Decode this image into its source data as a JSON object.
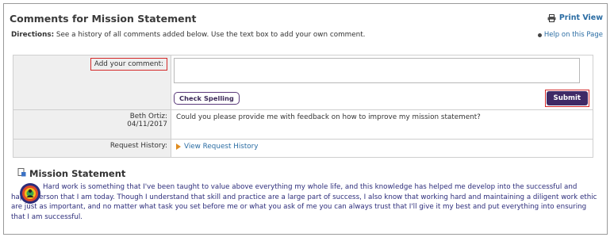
{
  "page": {
    "title": "Comments for Mission Statement",
    "print_view": "Print View",
    "directions_label": "Directions:",
    "directions_text": " See a history of all comments added below. Use the text box to add your own comment.",
    "help_link": "Help on this Page"
  },
  "form": {
    "add_comment_label": "Add your comment:",
    "comment_value": "",
    "check_spelling_label": "Check Spelling",
    "submit_label": "Submit",
    "comment_author": "Beth Ortiz:",
    "comment_date": "04/11/2017",
    "comment_text": "Could you please provide me with feedback on how to improve my mission statement?",
    "request_history_label": "Request History:",
    "request_history_link": "View Request History"
  },
  "mission": {
    "title": "Mission Statement",
    "text": "Hard work is something that I've been taught to value above everything my whole life, and this knowledge has helped me develop into the successful and happy person that I am today. Though I understand that skill and practice are a large part of success, I also know that working hard and maintaining a diligent work ethic are just as important, and no matter what task you set before me or what you ask of me you can always trust that I'll give it my best and put everything into ensuring that I am successful."
  },
  "colors": {
    "accent_purple": "#3f2a66",
    "link_blue": "#2a6ca3",
    "highlight_red": "#d42a2a",
    "mission_text": "#2c2c7a"
  },
  "icons": [
    "printer-icon",
    "help-icon",
    "arrow-right-icon",
    "document-icon",
    "mission-avatar-icon"
  ]
}
